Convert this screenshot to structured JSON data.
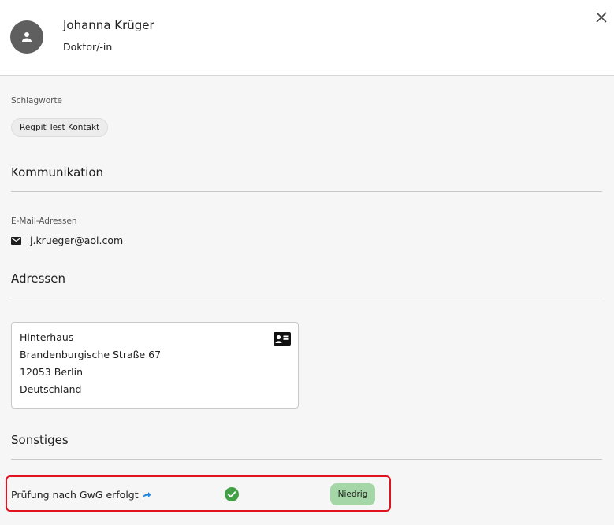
{
  "header": {
    "name": "Johanna Krüger",
    "role": "Doktor/-in",
    "avatar_icon": "person-icon",
    "close_icon": "close-icon"
  },
  "tags": {
    "label": "Schlagworte",
    "items": [
      "Regpit Test Kontakt"
    ]
  },
  "communication": {
    "title": "Kommunikation",
    "email_label": "E-Mail-Adressen",
    "email_icon": "mail-icon",
    "email": "j.krueger@aol.com"
  },
  "addresses": {
    "title": "Adressen",
    "card_icon": "contact-card-icon",
    "lines": [
      "Hinterhaus",
      "Brandenburgische Straße 67",
      "12053 Berlin",
      "Deutschland"
    ]
  },
  "other": {
    "title": "Sonstiges",
    "gwg_label": "Prüfung nach GwG erfolgt",
    "gwg_link_icon": "share-arrow-icon",
    "gwg_status_icon": "check-circle-icon",
    "risk_label": "Niedrig",
    "colors": {
      "check": "#43a047",
      "risk_badge": "#a5d6a7",
      "highlight_border": "#e0141e",
      "link_arrow": "#1e88e5"
    }
  }
}
